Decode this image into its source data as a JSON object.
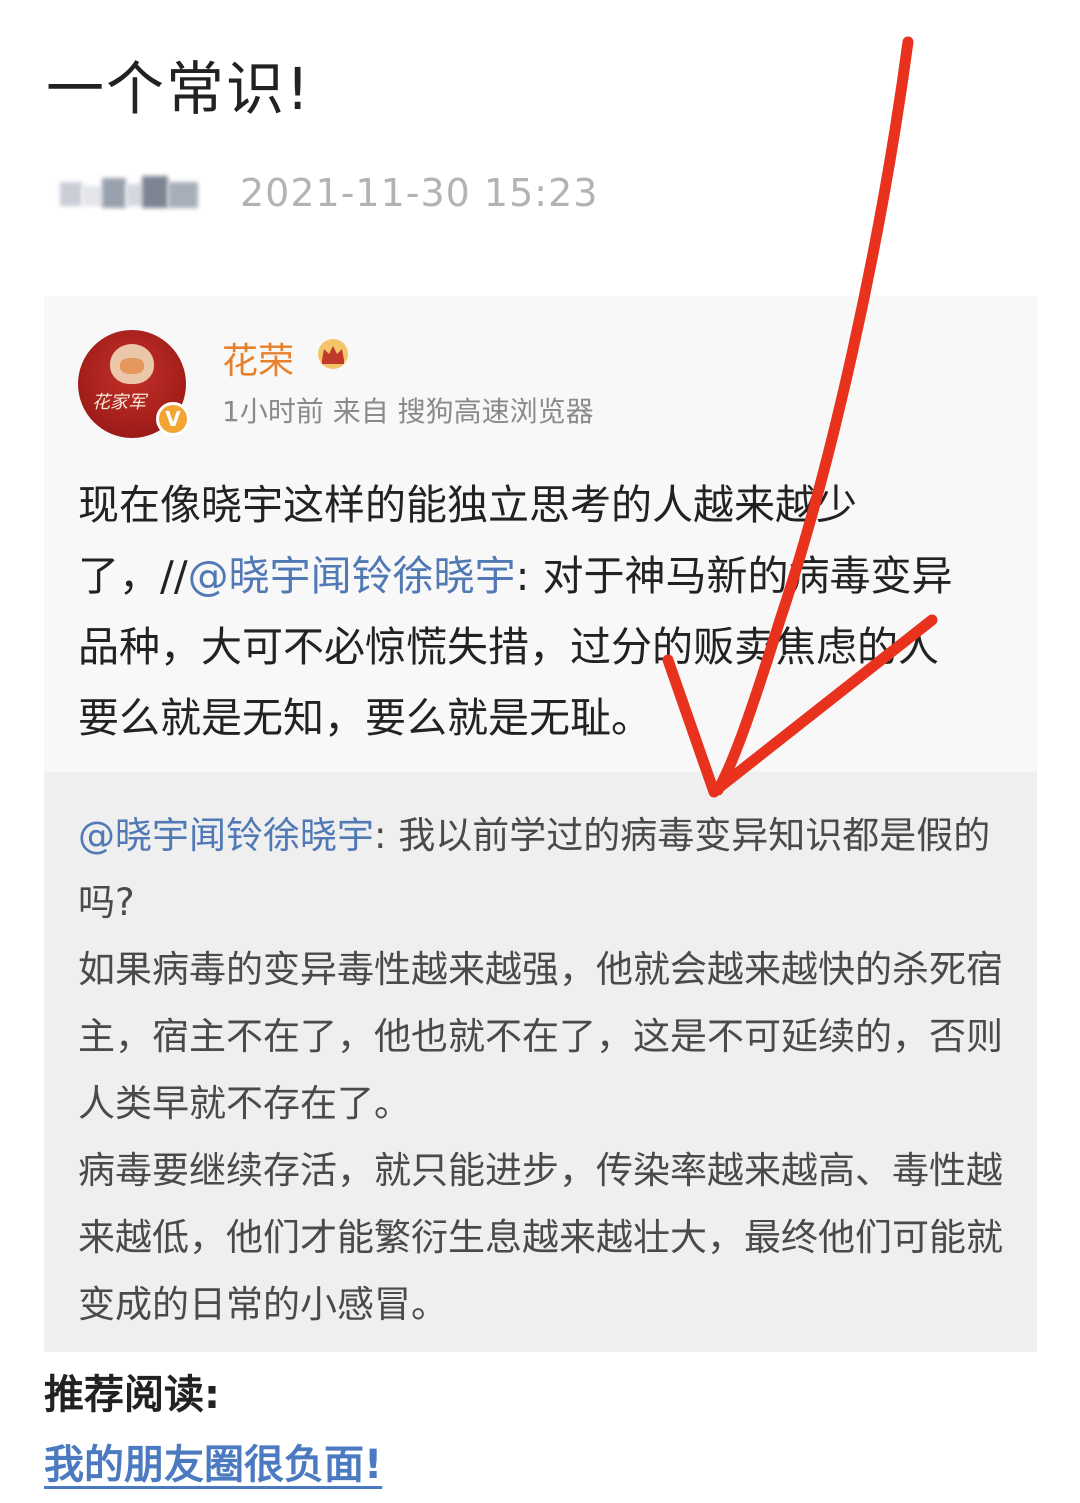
{
  "article": {
    "title": "一个常识!",
    "author_blurred": true,
    "publish_time": "2021-11-30 15:23"
  },
  "weibo": {
    "avatar_script": "花家军",
    "verified_badge": "V",
    "poster_name": "花荣",
    "meta": "1小时前 来自 搜狗高速浏览器",
    "body_before": "现在像晓宇这样的能独立思考的人越来越少了，//",
    "body_mention": "@晓宇闻铃徐晓宇",
    "body_after": ": 对于神马新的病毒变异品种，大可不必惊慌失措，过分的贩卖焦虑的人要么就是无知，要么就是无耻。",
    "retweet": {
      "mention": "@晓宇闻铃徐晓宇",
      "line1_text": ": 我以前学过的病毒变异知识都是假的吗?",
      "paragraph2": "如果病毒的变异毒性越来越强，他就会越来越快的杀死宿主，宿主不在了，他也就不在了，这是不可延续的，否则人类早就不存在了。",
      "paragraph3": "病毒要继续存活，就只能进步，传染率越来越高、毒性越来越低，他们才能繁衍生息越来越壮大，最终他们可能就变成的日常的小感冒。"
    }
  },
  "recommended": {
    "title": "推荐阅读:",
    "link_text": "我的朋友圈很负面!"
  },
  "colors": {
    "accent_name": "#e8812c",
    "mention": "#5079b5",
    "link": "#4c7ac0",
    "arrow": "#e8321e"
  },
  "annotation": {
    "icon": "red-arrow-icon"
  }
}
